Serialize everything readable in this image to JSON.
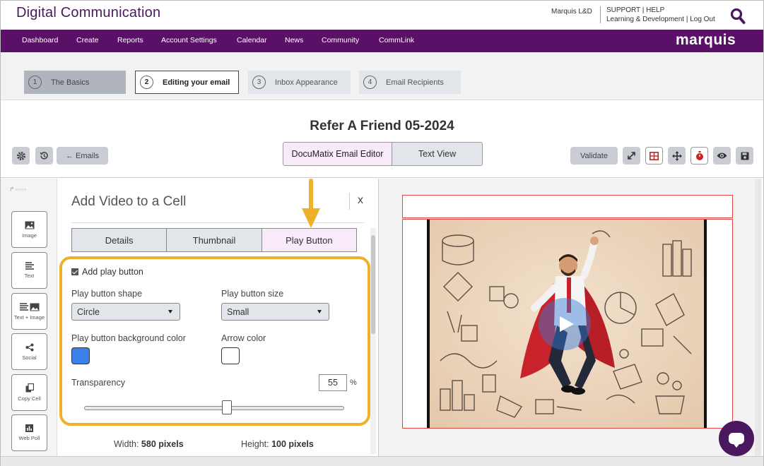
{
  "header": {
    "app_title": "Digital Communication",
    "user": "Marquis L&D",
    "links_line1": "SUPPORT | HELP",
    "links_line2": "Learning & Development | Log Out"
  },
  "nav": {
    "items": [
      "Dashboard",
      "Create",
      "Reports",
      "Account Settings",
      "Calendar",
      "News",
      "Community",
      "CommLink"
    ],
    "brand": "marquis"
  },
  "steps": [
    {
      "num": "1",
      "label": "The Basics"
    },
    {
      "num": "2",
      "label": "Editing your email"
    },
    {
      "num": "3",
      "label": "Inbox Appearance"
    },
    {
      "num": "4",
      "label": "Email Recipients"
    }
  ],
  "toolbar": {
    "doc_title": "Refer A Friend 05-2024",
    "emails_label": "← Emails",
    "toggle_a": "DocuMatix Email Editor",
    "toggle_b": "Text View",
    "validate_label": "Validate"
  },
  "tools": [
    {
      "label": "Image",
      "icon": "image-icon"
    },
    {
      "label": "Text",
      "icon": "text-icon"
    },
    {
      "label": "Text + Image",
      "icon": "text-image-icon"
    },
    {
      "label": "Social",
      "icon": "share-icon"
    },
    {
      "label": "Copy Cell",
      "icon": "copy-icon"
    },
    {
      "label": "Web Poll",
      "icon": "poll-icon"
    }
  ],
  "panel": {
    "title": "Add Video to a Cell",
    "close": "x",
    "tabs": [
      "Details",
      "Thumbnail",
      "Play Button"
    ],
    "active_tab": "Play Button",
    "add_play_button_label": "Add play button",
    "add_play_button_checked": true,
    "shape_label": "Play button shape",
    "shape_value": "Circle",
    "size_label": "Play button size",
    "size_value": "Small",
    "bg_color_label": "Play button background color",
    "bg_color": "#3a82ea",
    "arrow_color_label": "Arrow color",
    "arrow_color": "#ffffff",
    "transparency_label": "Transparency",
    "transparency_value": "55",
    "transparency_unit": "%",
    "width_label": "Width:",
    "width_value": "580 pixels",
    "height_label": "Height:",
    "height_value": "100 pixels"
  },
  "colors": {
    "brand_purple": "#5b1068",
    "highlight": "#f0b12a",
    "selection_red": "#dd4444"
  }
}
